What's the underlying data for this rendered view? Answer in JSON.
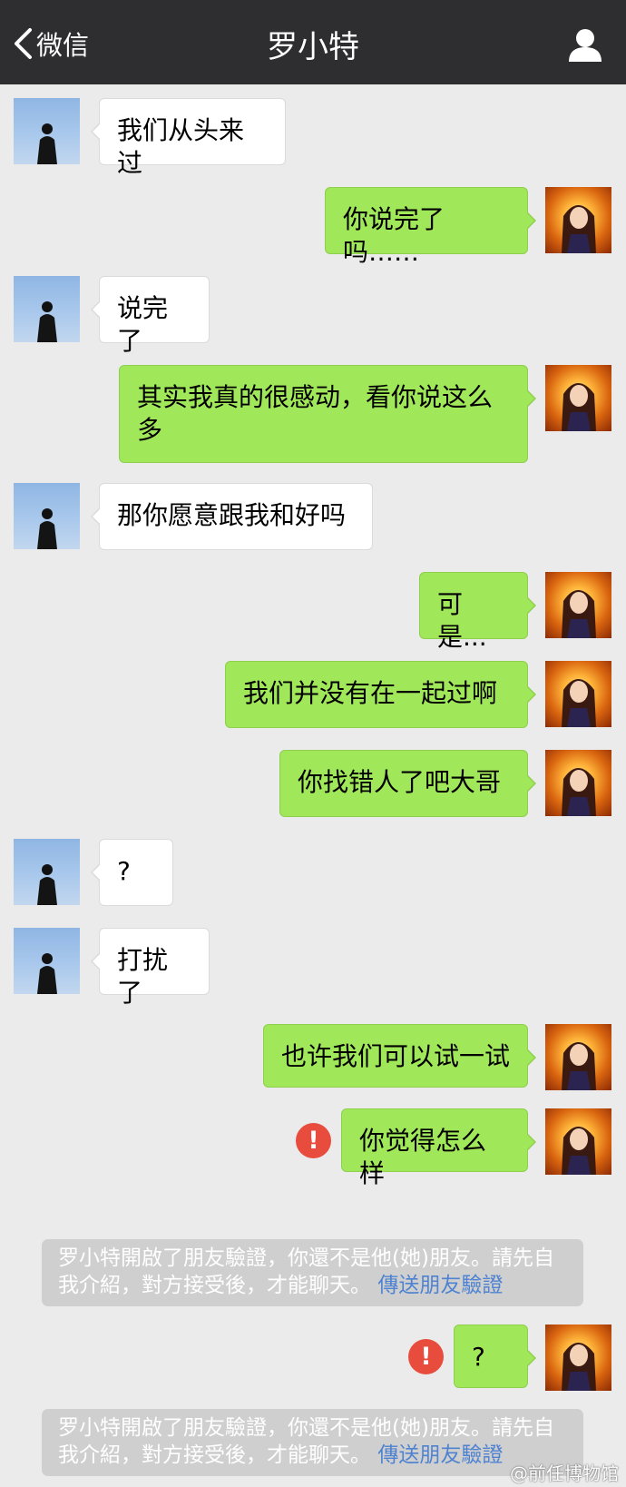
{
  "header": {
    "back_label": "微信",
    "title": "罗小特"
  },
  "messages": [
    {
      "side": "in",
      "text": "我们从头来过"
    },
    {
      "side": "out",
      "text": "你说完了吗……"
    },
    {
      "side": "in",
      "text": "说完了"
    },
    {
      "side": "out",
      "text": "其实我真的很感动，看你说这么多"
    },
    {
      "side": "in",
      "text": "那你愿意跟我和好吗"
    },
    {
      "side": "out",
      "text": "可是..."
    },
    {
      "side": "out",
      "text": "我们并没有在一起过啊"
    },
    {
      "side": "out",
      "text": "你找错人了吧大哥"
    },
    {
      "side": "in",
      "text": "?"
    },
    {
      "side": "in",
      "text": "打扰了"
    },
    {
      "side": "out",
      "text": "也许我们可以试一试"
    },
    {
      "side": "out",
      "text": "你觉得怎么样",
      "failed": true
    },
    {
      "side": "out",
      "text": "?",
      "failed": true
    }
  ],
  "system_notices": [
    {
      "text": "罗小特開啟了朋友驗證，你還不是他(她)朋友。請先自我介紹，對方接受後，才能聊天。",
      "link": "傳送朋友驗證"
    },
    {
      "text": "罗小特開啟了朋友驗證，你還不是他(她)朋友。請先自我介紹，對方接受後，才能聊天。",
      "link": "傳送朋友驗證"
    }
  ],
  "failed_icon": "!",
  "watermark": "@前任博物馆",
  "colors": {
    "header_bg": "#2e2e31",
    "chat_bg": "#ebebeb",
    "out_bubble": "#a0e75a",
    "in_bubble": "#ffffff",
    "error": "#e74c3c",
    "link": "#4f83d1"
  },
  "icons": {
    "back": "chevron-left-icon",
    "profile": "person-icon",
    "failed": "exclamation-icon"
  }
}
